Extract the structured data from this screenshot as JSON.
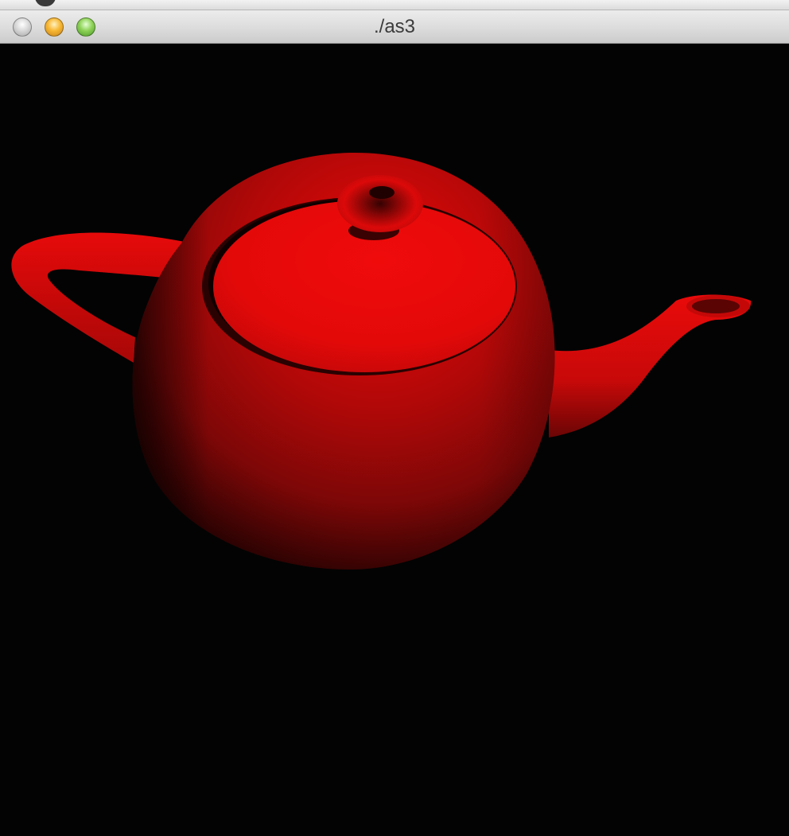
{
  "window": {
    "title": "./as3",
    "controls": {
      "close": "close-button",
      "minimize": "minimize-button",
      "zoom": "zoom-button"
    }
  },
  "scene": {
    "background_color": "#030303",
    "object": "teapot",
    "object_color": "#e60a0a",
    "shading": "smooth"
  },
  "icons": {
    "close": "close-icon",
    "minimize": "minimize-icon",
    "zoom": "zoom-icon"
  }
}
